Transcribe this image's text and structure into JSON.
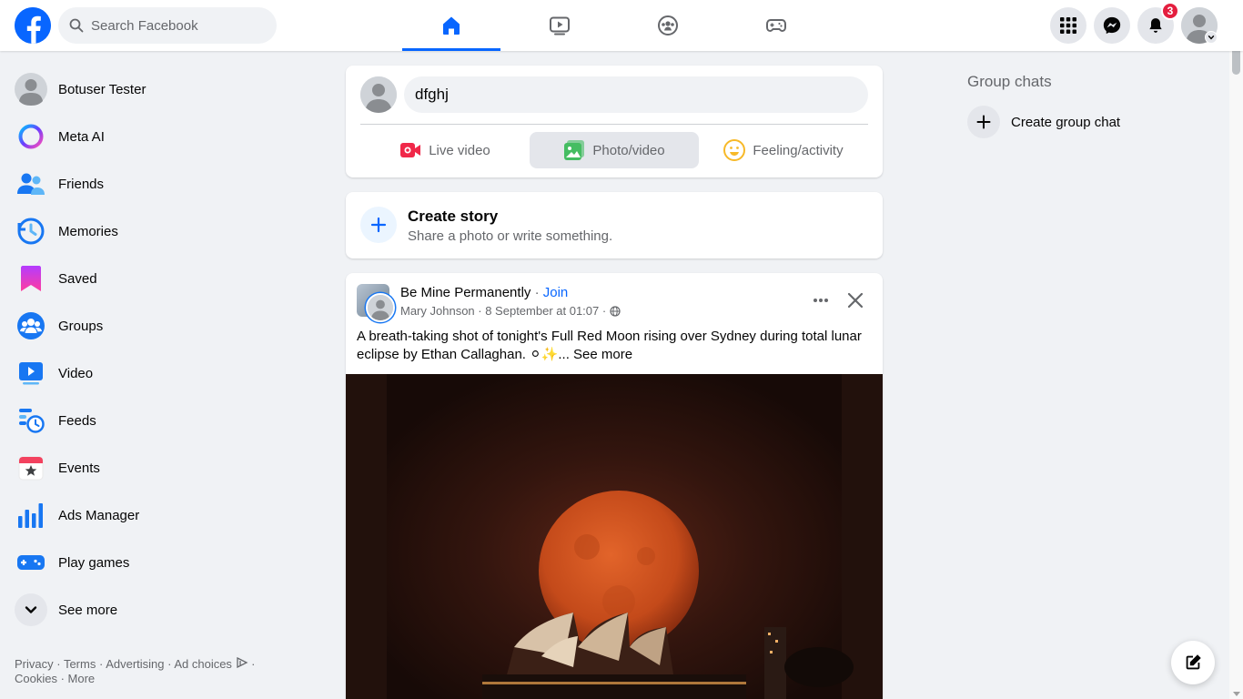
{
  "search": {
    "placeholder": "Search Facebook"
  },
  "nav": {
    "tabs": [
      {
        "name": "home",
        "active": true
      },
      {
        "name": "video"
      },
      {
        "name": "groups"
      },
      {
        "name": "gaming"
      }
    ]
  },
  "header_right": {
    "notification_count": "3"
  },
  "sidebar": {
    "items": [
      {
        "label": "Botuser Tester",
        "icon": "profile-avatar-icon"
      },
      {
        "label": "Meta AI",
        "icon": "meta-ai-icon"
      },
      {
        "label": "Friends",
        "icon": "friends-icon"
      },
      {
        "label": "Memories",
        "icon": "memories-icon"
      },
      {
        "label": "Saved",
        "icon": "saved-icon"
      },
      {
        "label": "Groups",
        "icon": "groups-icon"
      },
      {
        "label": "Video",
        "icon": "video-icon"
      },
      {
        "label": "Feeds",
        "icon": "feeds-icon"
      },
      {
        "label": "Events",
        "icon": "events-icon"
      },
      {
        "label": "Ads Manager",
        "icon": "ads-manager-icon"
      },
      {
        "label": "Play games",
        "icon": "play-games-icon"
      },
      {
        "label": "See more",
        "icon": "chevron-down-icon"
      }
    ],
    "footer": {
      "privacy": "Privacy",
      "terms": "Terms",
      "advertising": "Advertising",
      "ad_choices": "Ad choices",
      "cookies": "Cookies",
      "more": "More"
    }
  },
  "composer": {
    "input_value": "dfghj",
    "actions": {
      "live": "Live video",
      "photo": "Photo/video",
      "feeling": "Feeling/activity"
    }
  },
  "story": {
    "title": "Create story",
    "subtitle": "Share a photo or write something."
  },
  "post": {
    "group_name": "Be Mine Permanently",
    "join": "Join",
    "author": "Mary Johnson",
    "timestamp": "8 September at 01:07",
    "text": "A breath-taking shot of tonight's Full Red Moon rising over Sydney during total lunar eclipse by Ethan Callaghan. ⚪✨...",
    "see_more": "See more"
  },
  "right_column": {
    "title": "Group chats",
    "create": "Create group chat"
  },
  "colors": {
    "brand_blue": "#0866ff",
    "badge_red": "#e41e3f",
    "background": "#f0f2f5"
  }
}
